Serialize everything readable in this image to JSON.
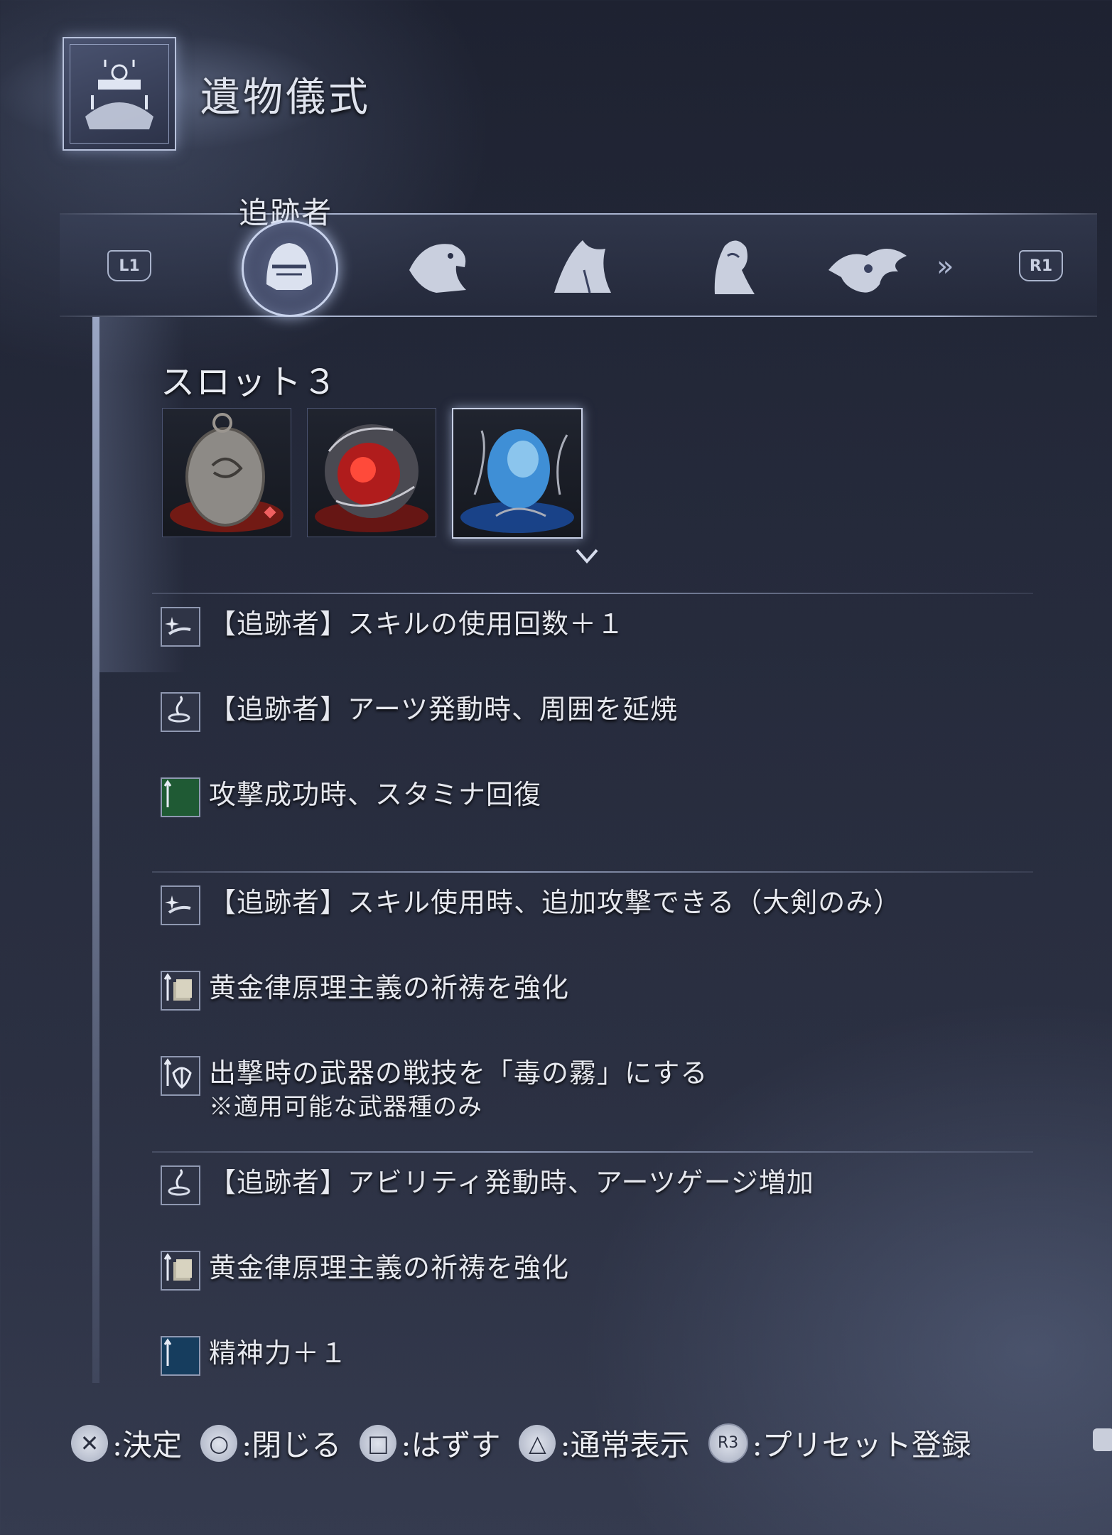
{
  "header": {
    "title": "遺物儀式"
  },
  "characters": {
    "selected_name": "追跡者",
    "prev_button": "L1",
    "next_button": "R1",
    "items": [
      {
        "icon": "helmet-knight-icon",
        "selected": true
      },
      {
        "icon": "eagle-head-icon",
        "selected": false
      },
      {
        "icon": "hooded-figure-icon",
        "selected": false
      },
      {
        "icon": "woman-profile-icon",
        "selected": false
      },
      {
        "icon": "dragon-crest-icon",
        "selected": false
      }
    ]
  },
  "slot": {
    "label": "スロット３",
    "relics": [
      {
        "icon": "medallion-relic-icon",
        "glow_color": "#d02a1a",
        "selected": false
      },
      {
        "icon": "red-orb-relic-icon",
        "glow_color": "#d82a22",
        "selected": false
      },
      {
        "icon": "blue-orb-relic-icon",
        "glow_color": "#2a7ad8",
        "selected": true
      }
    ]
  },
  "effect_groups": [
    [
      {
        "icon": "skill-icon",
        "text": "【追跡者】スキルの使用回数＋１"
      },
      {
        "icon": "arts-icon",
        "text": "【追跡者】アーツ発動時、周囲を延焼"
      },
      {
        "icon": "stat-green-icon",
        "text": "攻撃成功時、スタミナ回復"
      }
    ],
    [
      {
        "icon": "skill-icon",
        "text": "【追跡者】スキル使用時、追加攻撃できる（大剣のみ）"
      },
      {
        "icon": "scroll-icon",
        "text": "黄金律原理主義の祈祷を強化"
      },
      {
        "icon": "weapon-skill-icon",
        "text": "出撃時の武器の戦技を「毒の霧」にする",
        "note": "※適用可能な武器種のみ"
      }
    ],
    [
      {
        "icon": "arts-icon",
        "text": "【追跡者】アビリティ発動時、アーツゲージ増加"
      },
      {
        "icon": "scroll-icon",
        "text": "黄金律原理主義の祈祷を強化"
      },
      {
        "icon": "stat-blue-icon",
        "text": "精神力＋１"
      }
    ]
  ],
  "footer": [
    {
      "icon": "cross-button-icon",
      "glyph": "✕",
      "label": ":決定"
    },
    {
      "icon": "circle-button-icon",
      "glyph": "○",
      "label": ":閉じる"
    },
    {
      "icon": "square-button-icon",
      "glyph": "□",
      "label": ":はずす"
    },
    {
      "icon": "triangle-button-icon",
      "glyph": "△",
      "label": ":通常表示"
    },
    {
      "icon": "r3-button-icon",
      "glyph": "R3",
      "label": ":プリセット登録"
    }
  ]
}
